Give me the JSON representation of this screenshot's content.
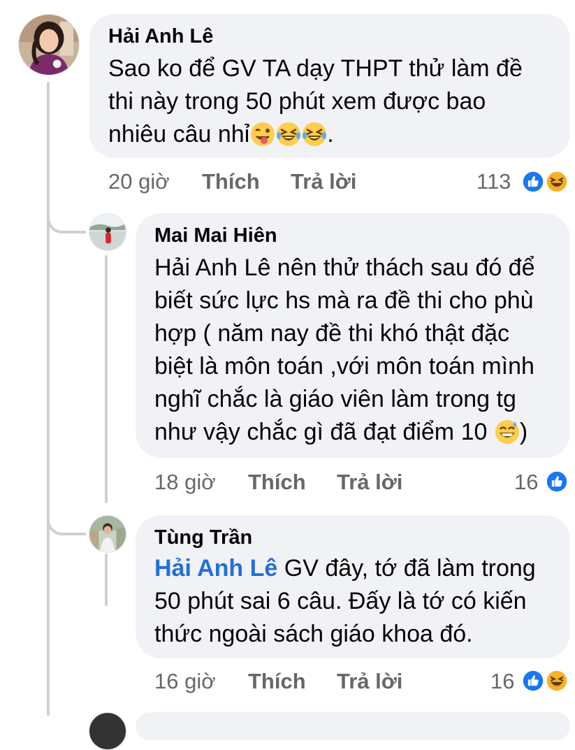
{
  "comments": [
    {
      "author": "Hải Anh Lê",
      "text_lines": [
        "Sao ko để GV TA dạy THPT thử làm đề",
        "thi này trong 50 phút xem được bao",
        "nhiêu câu nhỉ"
      ],
      "text_end": ".",
      "inline_emojis": [
        "winking-tongue-emoji",
        "rolling-laughing-emoji",
        "rolling-laughing-emoji"
      ],
      "time": "20 giờ",
      "like_label": "Thích",
      "reply_label": "Trả lời",
      "reaction_count": "113",
      "reactions": [
        "like-reaction-icon",
        "haha-reaction-icon"
      ]
    },
    {
      "author": "Mai Mai Hiên",
      "text_lines": [
        "Hải Anh Lê nên thử thách sau đó để",
        "biết sức lực hs mà ra đề thi cho phù",
        "hợp ( năm nay đề thi khó thật đặc",
        "biệt là môn toán ,với môn toán mình",
        "nghĩ chắc là giáo viên làm trong tg",
        "như vậy chắc gì đã đạt điểm 10 "
      ],
      "text_end": ")",
      "inline_emojis": [
        "sweat-smile-emoji"
      ],
      "time": "18 giờ",
      "like_label": "Thích",
      "reply_label": "Trả lời",
      "reaction_count": "16",
      "reactions": [
        "like-reaction-icon"
      ]
    },
    {
      "author": "Tùng Trần",
      "mention": "Hải Anh Lê",
      "text_lines": [
        " GV đây, tớ đã làm trong",
        "50 phút sai 6 câu. Đấy là tớ có kiến",
        "thức ngoài sách giáo khoa đó."
      ],
      "time": "16 giờ",
      "like_label": "Thích",
      "reply_label": "Trả lời",
      "reaction_count": "16",
      "reactions": [
        "like-reaction-icon",
        "haha-reaction-icon"
      ]
    }
  ],
  "colors": {
    "bubble": "#f0f2f5",
    "meta_text": "#65676b",
    "mention": "#216fdb",
    "like_blue": "#1877f2",
    "thread_line": "#ced0d4"
  }
}
